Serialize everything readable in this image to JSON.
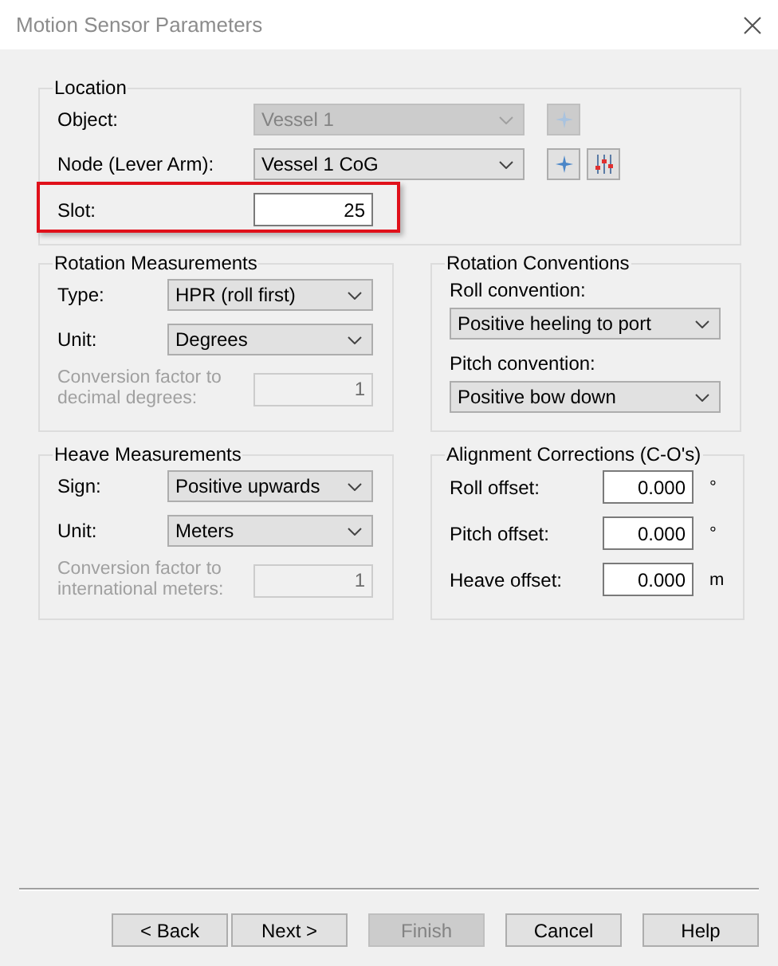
{
  "window": {
    "title": "Motion Sensor Parameters"
  },
  "location": {
    "title": "Location",
    "rows": [
      {
        "kind": "combo",
        "label": "Object:",
        "value": "Vessel 1",
        "disabled": true,
        "buttons": [
          {
            "kind": "add",
            "disabled": true
          }
        ]
      },
      {
        "kind": "combo",
        "label": "Node (Lever Arm):",
        "value": "Vessel 1 CoG",
        "disabled": false,
        "buttons": [
          {
            "kind": "add",
            "disabled": false
          },
          {
            "kind": "sliders",
            "disabled": false
          }
        ]
      },
      {
        "kind": "field",
        "label": "Slot:",
        "value": "25",
        "disabled": false,
        "highlighted": true
      }
    ]
  },
  "rotation_measurements": {
    "title": "Rotation Measurements",
    "rows": [
      {
        "kind": "combo",
        "label": "Type:",
        "value": "HPR (roll first)",
        "disabled": false
      },
      {
        "kind": "combo",
        "label": "Unit:",
        "value": "Degrees",
        "disabled": false
      },
      {
        "kind": "field",
        "label": "Conversion factor to decimal degrees:",
        "value": "1",
        "disabled": true
      }
    ]
  },
  "rotation_conventions": {
    "title": "Rotation Conventions",
    "rows": [
      {
        "kind": "stacked-combo",
        "label": "Roll convention:",
        "value": "Positive heeling to port",
        "disabled": false
      },
      {
        "kind": "stacked-combo",
        "label": "Pitch convention:",
        "value": "Positive bow down",
        "disabled": false
      }
    ]
  },
  "heave_measurements": {
    "title": "Heave Measurements",
    "rows": [
      {
        "kind": "combo",
        "label": "Sign:",
        "value": "Positive upwards",
        "disabled": false
      },
      {
        "kind": "combo",
        "label": "Unit:",
        "value": "Meters",
        "disabled": false
      },
      {
        "kind": "field",
        "label": "Conversion factor to international meters:",
        "value": "1",
        "disabled": true
      }
    ]
  },
  "alignment_corrections": {
    "title": "Alignment Corrections (C-O's)",
    "rows": [
      {
        "kind": "field",
        "label": "Roll offset:",
        "value": "0.000",
        "unit": "°",
        "disabled": false
      },
      {
        "kind": "field",
        "label": "Pitch offset:",
        "value": "0.000",
        "unit": "°",
        "disabled": false
      },
      {
        "kind": "field",
        "label": "Heave offset:",
        "value": "0.000",
        "unit": "m",
        "disabled": false
      }
    ]
  },
  "buttons": [
    {
      "label": "< Back",
      "disabled": false
    },
    {
      "label": "Next >",
      "disabled": false
    },
    {
      "label": "Finish",
      "disabled": true
    },
    {
      "label": "Cancel",
      "disabled": false
    },
    {
      "label": "Help",
      "disabled": false
    }
  ]
}
